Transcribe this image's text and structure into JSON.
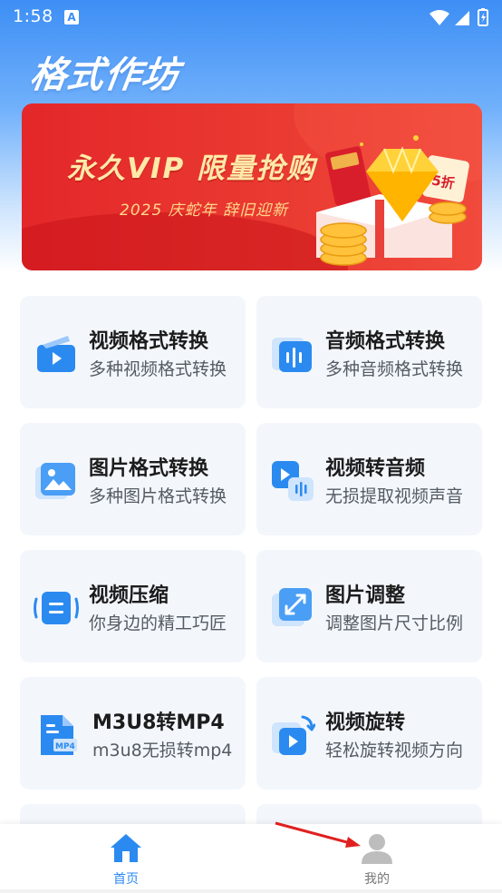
{
  "status_bar": {
    "time": "1:58",
    "notification_icon": "A"
  },
  "app": {
    "title": "格式作坊"
  },
  "banner": {
    "title": "永久VIP 限量抢购",
    "subtitle": "2025 庆蛇年 辞旧迎新",
    "discount_tag": "5折"
  },
  "tools": [
    {
      "title": "视频格式转换",
      "subtitle": "多种视频格式转换",
      "icon": "video-play-icon"
    },
    {
      "title": "音频格式转换",
      "subtitle": "多种音频格式转换",
      "icon": "audio-wave-icon"
    },
    {
      "title": "图片格式转换",
      "subtitle": "多种图片格式转换",
      "icon": "image-icon"
    },
    {
      "title": "视频转音频",
      "subtitle": "无损提取视频声音",
      "icon": "video-to-audio-icon"
    },
    {
      "title": "视频压缩",
      "subtitle": "你身边的精工巧匠",
      "icon": "compress-icon"
    },
    {
      "title": "图片调整",
      "subtitle": "调整图片尺寸比例",
      "icon": "resize-icon"
    },
    {
      "title": "M3U8转MP4",
      "subtitle": "m3u8无损转mp4",
      "icon": "mp4-file-icon"
    },
    {
      "title": "视频旋转",
      "subtitle": "轻松旋转视频方向",
      "icon": "rotate-video-icon"
    }
  ],
  "tabbar": {
    "home_label": "首页",
    "mine_label": "我的",
    "active": "home"
  },
  "colors": {
    "accent": "#2b8af0",
    "header_gradient_top": "#3d8ef5",
    "banner_red": "#e4272a",
    "card_bg": "#f3f7fc",
    "annotation_arrow": "#e02020"
  }
}
